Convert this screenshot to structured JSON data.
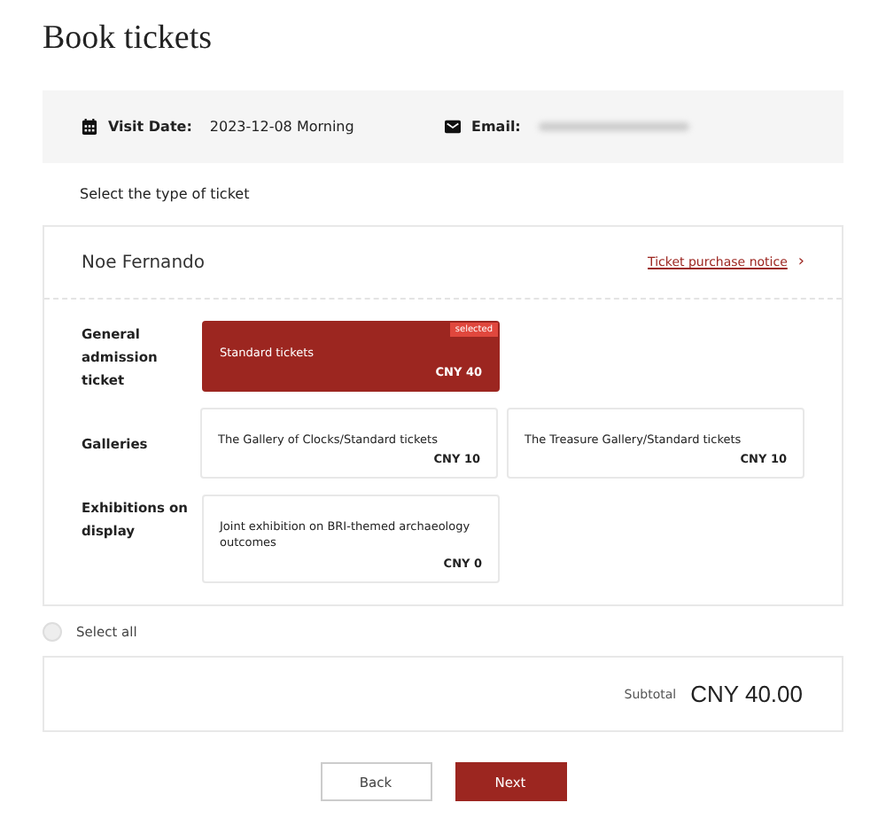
{
  "title": "Book tickets",
  "info": {
    "visit_label": "Visit Date:",
    "visit_value": "2023-12-08 Morning",
    "email_label": "Email:"
  },
  "prompt": "Select the type of ticket",
  "visitor": {
    "name": "Noe Fernando",
    "notice_link": "Ticket purchase notice",
    "notice_arrow": "›"
  },
  "groups": [
    {
      "label": "General admission ticket",
      "tickets": [
        {
          "name": "Standard tickets",
          "price": "CNY 40",
          "selected": true,
          "badge": "selected"
        }
      ]
    },
    {
      "label": "Galleries",
      "tickets": [
        {
          "name": "The Gallery of Clocks/Standard tickets",
          "price": "CNY 10",
          "selected": false
        },
        {
          "name": "The Treasure Gallery/Standard tickets",
          "price": "CNY 10",
          "selected": false
        }
      ]
    },
    {
      "label": "Exhibitions on display",
      "tickets": [
        {
          "name": "Joint exhibition on BRI-themed archaeology outcomes",
          "price": "CNY 0",
          "selected": false
        }
      ]
    }
  ],
  "select_all": {
    "label": "Select all",
    "checked": false
  },
  "subtotal": {
    "label": "Subtotal",
    "value": "CNY 40.00"
  },
  "buttons": [
    {
      "label": "Back",
      "kind": "secondary"
    },
    {
      "label": "Next",
      "kind": "primary"
    }
  ]
}
